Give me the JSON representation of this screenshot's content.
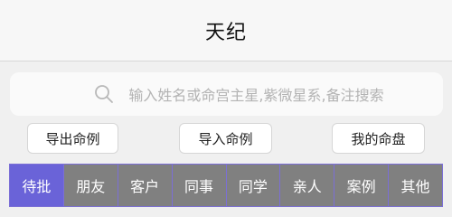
{
  "header": {
    "title": "天纪"
  },
  "search": {
    "placeholder": "输入姓名或命宫主星,紫微星系,备注搜索",
    "icon": "search-icon"
  },
  "actions": {
    "export_label": "导出命例",
    "import_label": "导入命例",
    "my_chart_label": "我的命盘"
  },
  "tabs": [
    {
      "label": "待批",
      "active": true
    },
    {
      "label": "朋友"
    },
    {
      "label": "客户"
    },
    {
      "label": "同事"
    },
    {
      "label": "同学"
    },
    {
      "label": "亲人"
    },
    {
      "label": "案例"
    },
    {
      "label": "其他"
    }
  ],
  "colors": {
    "active_tab": "#6a63d8",
    "inactive_tab": "#808080",
    "tab_border": "#7b6fd6"
  }
}
